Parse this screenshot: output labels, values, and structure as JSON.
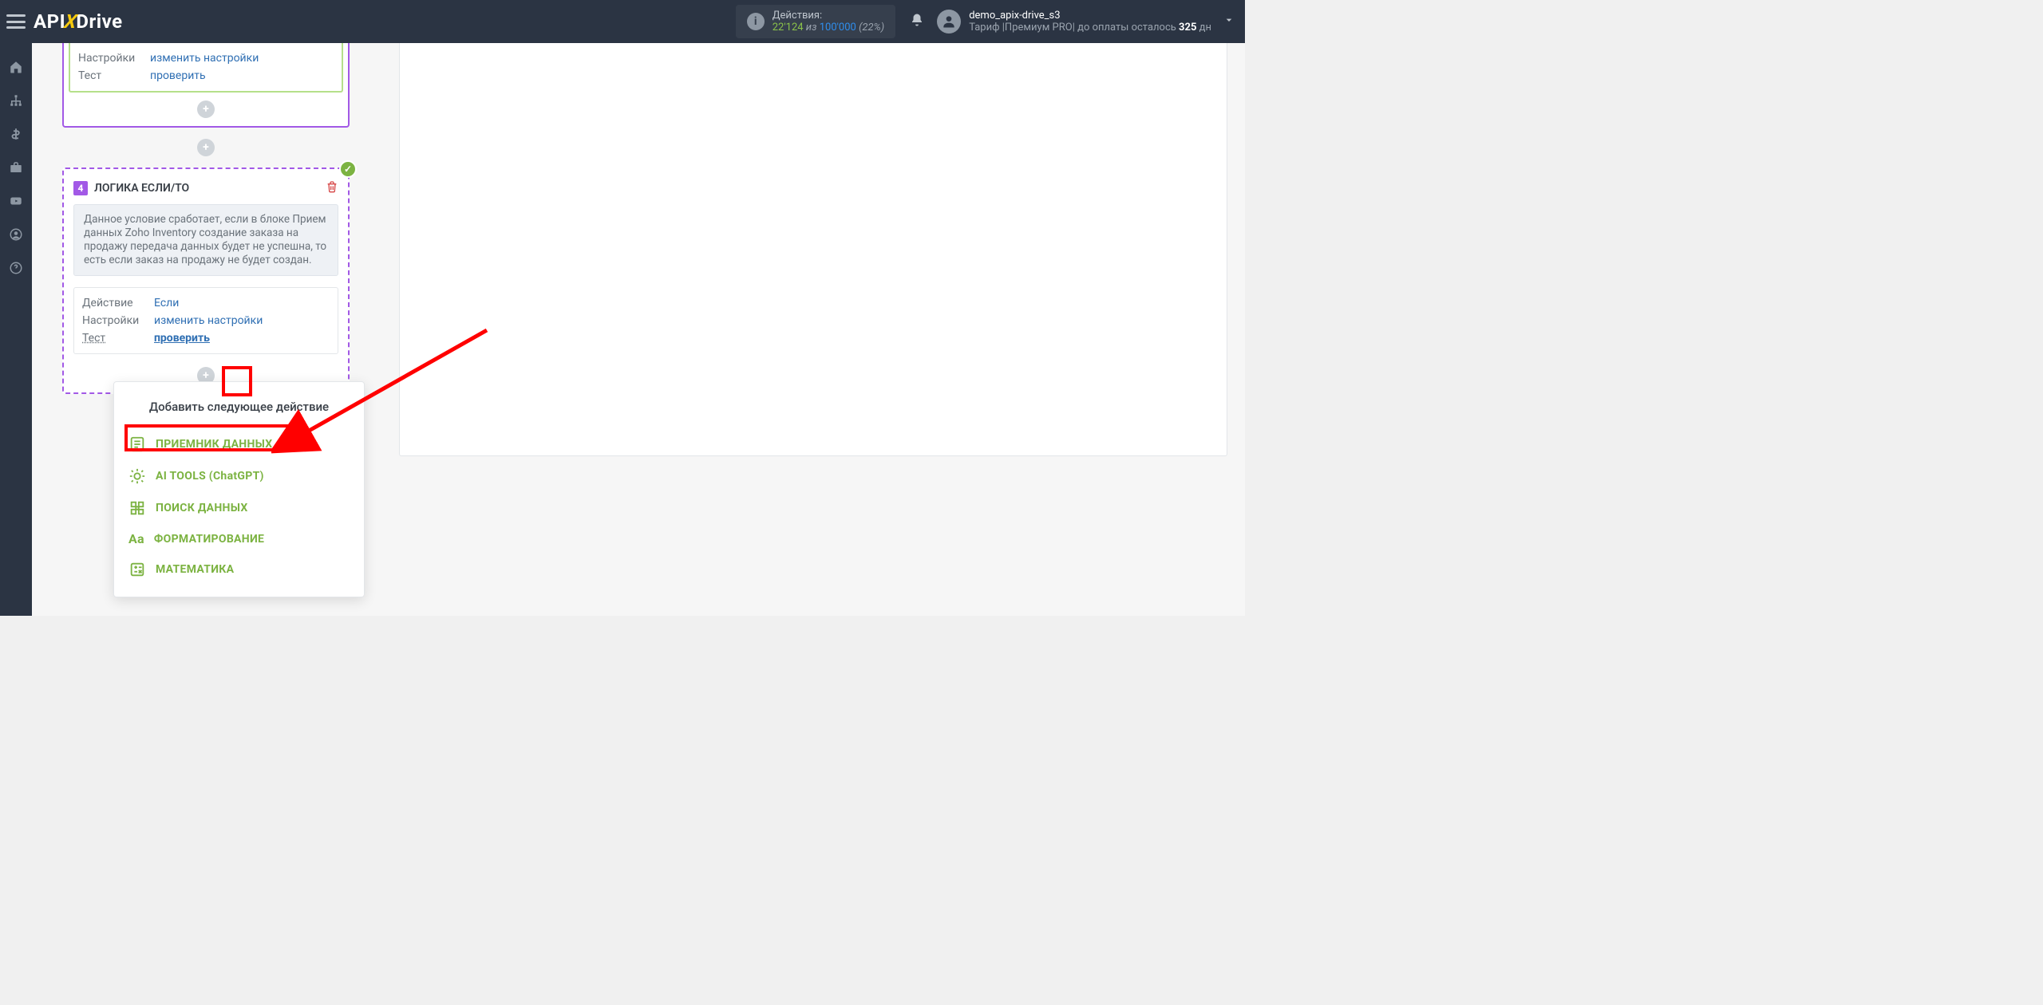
{
  "header": {
    "actions_label": "Действия:",
    "actions_current": "22'124",
    "actions_of": "из",
    "actions_total": "100'000",
    "actions_pct": "(22%)"
  },
  "user": {
    "name": "demo_apix-drive_s3",
    "tariff": "Тариф |Премиум PRO| до оплаты осталось ",
    "days": "325",
    "days_suffix": " дн"
  },
  "prev_card": {
    "r1_label": "Настройки",
    "r1_link": "изменить настройки",
    "r2_label": "Тест",
    "r2_link": "проверить"
  },
  "logic_card": {
    "num": "4",
    "title": "ЛОГИКА ЕСЛИ/ТО",
    "note": "Данное условие сработает, если в блоке Прием данных Zoho Inventory создание заказа на продажу передача данных будет не успешна, то есть если заказ на продажу не будет создан.",
    "r1_label": "Действие",
    "r1_val": "Если",
    "r2_label": "Настройки",
    "r2_val": "изменить настройки",
    "r3_label": "Тест",
    "r3_val": "проверить"
  },
  "popup": {
    "title": "Добавить следующее действие",
    "items": [
      "ПРИЕМНИК ДАННЫХ",
      "AI TOOLS (ChatGPT)",
      "ПОИСК ДАННЫХ",
      "ФОРМАТИРОВАНИЕ",
      "МАТЕМАТИКА"
    ]
  }
}
